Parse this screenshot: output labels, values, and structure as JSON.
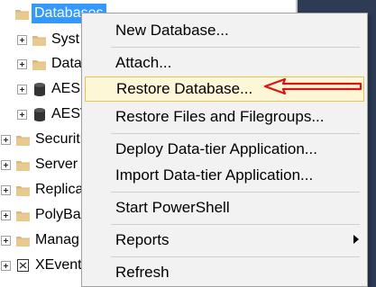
{
  "tree": {
    "databases_label": "Databases",
    "items": [
      {
        "label": "Syst",
        "icon": "folder-icon"
      },
      {
        "label": "Data",
        "icon": "folder-icon"
      },
      {
        "label": "AES",
        "icon": "database-icon"
      },
      {
        "label": "AESV",
        "icon": "database-icon"
      },
      {
        "label": "Securit",
        "icon": "folder-icon"
      },
      {
        "label": "Server",
        "icon": "folder-icon"
      },
      {
        "label": "Replica",
        "icon": "folder-icon"
      },
      {
        "label": "PolyBa",
        "icon": "folder-icon"
      },
      {
        "label": "Manag",
        "icon": "folder-icon"
      },
      {
        "label": "XEvent",
        "icon": "xevent-icon"
      }
    ]
  },
  "context_menu": {
    "new_database": "New Database...",
    "attach": "Attach...",
    "restore_database": "Restore Database...",
    "restore_files": "Restore Files and Filegroups...",
    "deploy_data_tier": "Deploy Data-tier Application...",
    "import_data_tier": "Import Data-tier Application...",
    "start_powershell": "Start PowerShell",
    "reports": "Reports",
    "refresh": "Refresh"
  },
  "colors": {
    "selection": "#3399ff",
    "highlight_bg": "#fdf7d8",
    "highlight_border": "#e6c553",
    "annotation_arrow": "#e01010",
    "folder": "#dcb67a",
    "dark_panel": "#2d3b55"
  }
}
